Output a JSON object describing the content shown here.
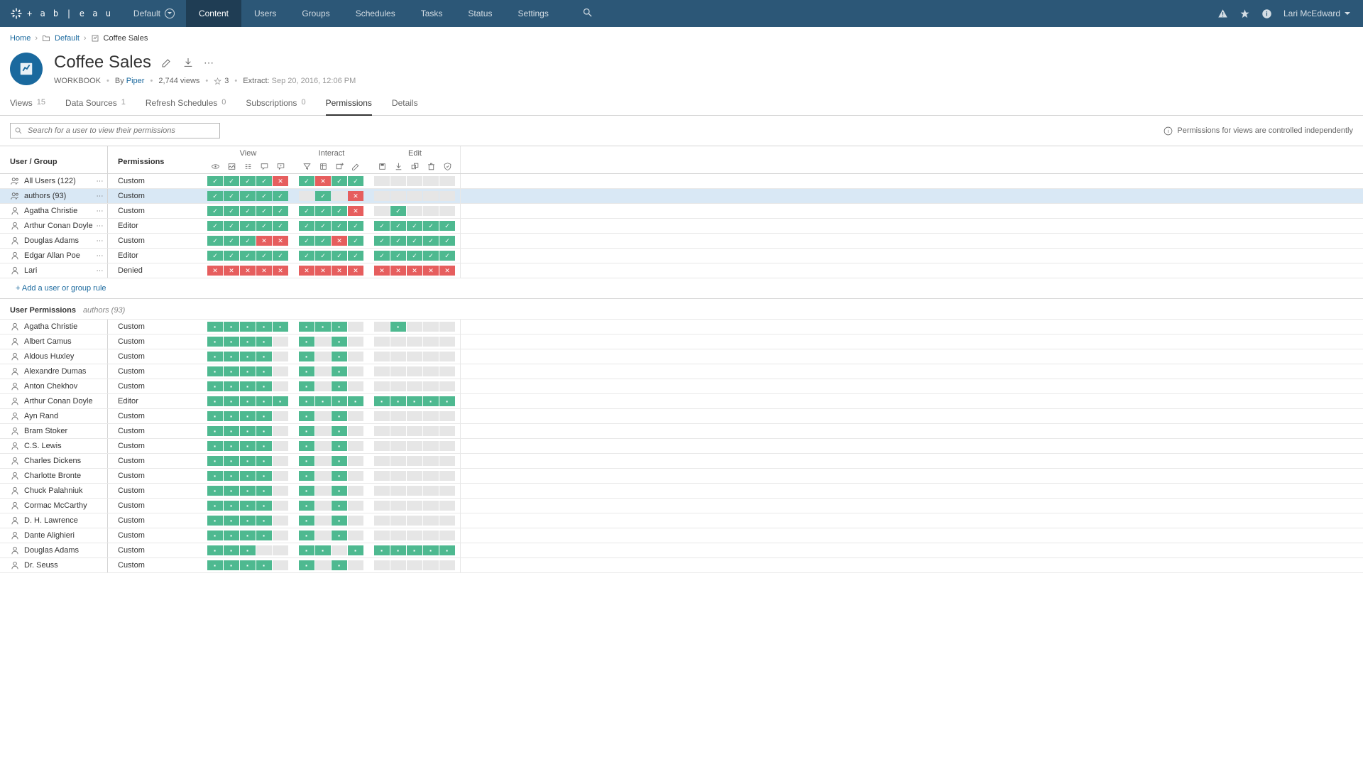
{
  "nav": {
    "site": "Default",
    "items": [
      "Content",
      "Users",
      "Groups",
      "Schedules",
      "Tasks",
      "Status",
      "Settings"
    ],
    "active": 0,
    "username": "Lari McEdward"
  },
  "breadcrumb": {
    "home": "Home",
    "site": "Default",
    "current": "Coffee Sales"
  },
  "header": {
    "title": "Coffee Sales",
    "type": "WORKBOOK",
    "by_label": "By",
    "owner": "Piper",
    "views": "2,744 views",
    "stars": "3",
    "extract_label": "Extract:",
    "extract_time": "Sep 20, 2016, 12:06 PM"
  },
  "tabs": [
    {
      "label": "Views",
      "count": "15"
    },
    {
      "label": "Data Sources",
      "count": "1"
    },
    {
      "label": "Refresh Schedules",
      "count": "0"
    },
    {
      "label": "Subscriptions",
      "count": "0"
    },
    {
      "label": "Permissions"
    },
    {
      "label": "Details"
    }
  ],
  "search_placeholder": "Search for a user to view their permissions",
  "info_notice": "Permissions for views are controlled independently",
  "grid": {
    "col_ug": "User / Group",
    "col_perm": "Permissions",
    "groups": [
      "View",
      "Interact",
      "Edit"
    ]
  },
  "rules": [
    {
      "type": "group",
      "name": "All Users (122)",
      "perm": "Custom",
      "view": [
        "a",
        "a",
        "a",
        "a",
        "d"
      ],
      "interact": [
        "a",
        "d",
        "a",
        "a"
      ],
      "edit": [
        "n",
        "n",
        "n",
        "n",
        "n"
      ]
    },
    {
      "type": "group",
      "name": "authors (93)",
      "perm": "Custom",
      "selected": true,
      "view": [
        "a",
        "a",
        "a",
        "a",
        "a"
      ],
      "interact": [
        "n",
        "a",
        "n",
        "d"
      ],
      "edit": [
        "n",
        "n",
        "n",
        "n",
        "n"
      ]
    },
    {
      "type": "user",
      "name": "Agatha Christie",
      "perm": "Custom",
      "view": [
        "a",
        "a",
        "a",
        "a",
        "a"
      ],
      "interact": [
        "a",
        "a",
        "a",
        "d"
      ],
      "edit": [
        "n",
        "a",
        "n",
        "n",
        "n"
      ]
    },
    {
      "type": "user",
      "name": "Arthur Conan Doyle",
      "perm": "Editor",
      "view": [
        "a",
        "a",
        "a",
        "a",
        "a"
      ],
      "interact": [
        "a",
        "a",
        "a",
        "a"
      ],
      "edit": [
        "a",
        "a",
        "a",
        "a",
        "a"
      ]
    },
    {
      "type": "user",
      "name": "Douglas Adams",
      "perm": "Custom",
      "view": [
        "a",
        "a",
        "a",
        "d",
        "d"
      ],
      "interact": [
        "a",
        "a",
        "d",
        "a"
      ],
      "edit": [
        "a",
        "a",
        "a",
        "a",
        "a"
      ]
    },
    {
      "type": "user",
      "name": "Edgar Allan Poe",
      "perm": "Editor",
      "view": [
        "a",
        "a",
        "a",
        "a",
        "a"
      ],
      "interact": [
        "a",
        "a",
        "a",
        "a"
      ],
      "edit": [
        "a",
        "a",
        "a",
        "a",
        "a"
      ]
    },
    {
      "type": "user",
      "name": "Lari",
      "perm": "Denied",
      "view": [
        "d",
        "d",
        "d",
        "d",
        "d"
      ],
      "interact": [
        "d",
        "d",
        "d",
        "d"
      ],
      "edit": [
        "d",
        "d",
        "d",
        "d",
        "d"
      ]
    }
  ],
  "add_rule": "+ Add a user or group rule",
  "user_perms": {
    "title": "User Permissions",
    "sub": "authors (93)",
    "rows": [
      {
        "name": "Agatha Christie",
        "perm": "Custom",
        "view": [
          "o",
          "o",
          "o",
          "o",
          "o"
        ],
        "interact": [
          "o",
          "o",
          "o",
          "n"
        ],
        "edit": [
          "n",
          "o",
          "n",
          "n",
          "n"
        ]
      },
      {
        "name": "Albert Camus",
        "perm": "Custom",
        "view": [
          "o",
          "o",
          "o",
          "o",
          "n"
        ],
        "interact": [
          "o",
          "n",
          "o",
          "n"
        ],
        "edit": [
          "n",
          "n",
          "n",
          "n",
          "n"
        ]
      },
      {
        "name": "Aldous Huxley",
        "perm": "Custom",
        "view": [
          "o",
          "o",
          "o",
          "o",
          "n"
        ],
        "interact": [
          "o",
          "n",
          "o",
          "n"
        ],
        "edit": [
          "n",
          "n",
          "n",
          "n",
          "n"
        ]
      },
      {
        "name": "Alexandre Dumas",
        "perm": "Custom",
        "view": [
          "o",
          "o",
          "o",
          "o",
          "n"
        ],
        "interact": [
          "o",
          "n",
          "o",
          "n"
        ],
        "edit": [
          "n",
          "n",
          "n",
          "n",
          "n"
        ]
      },
      {
        "name": "Anton Chekhov",
        "perm": "Custom",
        "view": [
          "o",
          "o",
          "o",
          "o",
          "n"
        ],
        "interact": [
          "o",
          "n",
          "o",
          "n"
        ],
        "edit": [
          "n",
          "n",
          "n",
          "n",
          "n"
        ]
      },
      {
        "name": "Arthur Conan Doyle",
        "perm": "Editor",
        "view": [
          "o",
          "o",
          "o",
          "o",
          "o"
        ],
        "interact": [
          "o",
          "o",
          "o",
          "o"
        ],
        "edit": [
          "o",
          "o",
          "o",
          "o",
          "o"
        ]
      },
      {
        "name": "Ayn Rand",
        "perm": "Custom",
        "view": [
          "o",
          "o",
          "o",
          "o",
          "n"
        ],
        "interact": [
          "o",
          "n",
          "o",
          "n"
        ],
        "edit": [
          "n",
          "n",
          "n",
          "n",
          "n"
        ]
      },
      {
        "name": "Bram Stoker",
        "perm": "Custom",
        "view": [
          "o",
          "o",
          "o",
          "o",
          "n"
        ],
        "interact": [
          "o",
          "n",
          "o",
          "n"
        ],
        "edit": [
          "n",
          "n",
          "n",
          "n",
          "n"
        ]
      },
      {
        "name": "C.S. Lewis",
        "perm": "Custom",
        "view": [
          "o",
          "o",
          "o",
          "o",
          "n"
        ],
        "interact": [
          "o",
          "n",
          "o",
          "n"
        ],
        "edit": [
          "n",
          "n",
          "n",
          "n",
          "n"
        ]
      },
      {
        "name": "Charles Dickens",
        "perm": "Custom",
        "view": [
          "o",
          "o",
          "o",
          "o",
          "n"
        ],
        "interact": [
          "o",
          "n",
          "o",
          "n"
        ],
        "edit": [
          "n",
          "n",
          "n",
          "n",
          "n"
        ]
      },
      {
        "name": "Charlotte Bronte",
        "perm": "Custom",
        "view": [
          "o",
          "o",
          "o",
          "o",
          "n"
        ],
        "interact": [
          "o",
          "n",
          "o",
          "n"
        ],
        "edit": [
          "n",
          "n",
          "n",
          "n",
          "n"
        ]
      },
      {
        "name": "Chuck Palahniuk",
        "perm": "Custom",
        "view": [
          "o",
          "o",
          "o",
          "o",
          "n"
        ],
        "interact": [
          "o",
          "n",
          "o",
          "n"
        ],
        "edit": [
          "n",
          "n",
          "n",
          "n",
          "n"
        ]
      },
      {
        "name": "Cormac McCarthy",
        "perm": "Custom",
        "view": [
          "o",
          "o",
          "o",
          "o",
          "n"
        ],
        "interact": [
          "o",
          "n",
          "o",
          "n"
        ],
        "edit": [
          "n",
          "n",
          "n",
          "n",
          "n"
        ]
      },
      {
        "name": "D. H. Lawrence",
        "perm": "Custom",
        "view": [
          "o",
          "o",
          "o",
          "o",
          "n"
        ],
        "interact": [
          "o",
          "n",
          "o",
          "n"
        ],
        "edit": [
          "n",
          "n",
          "n",
          "n",
          "n"
        ]
      },
      {
        "name": "Dante Alighieri",
        "perm": "Custom",
        "view": [
          "o",
          "o",
          "o",
          "o",
          "n"
        ],
        "interact": [
          "o",
          "n",
          "o",
          "n"
        ],
        "edit": [
          "n",
          "n",
          "n",
          "n",
          "n"
        ]
      },
      {
        "name": "Douglas Adams",
        "perm": "Custom",
        "view": [
          "o",
          "o",
          "o",
          "n",
          "n"
        ],
        "interact": [
          "o",
          "o",
          "n",
          "o"
        ],
        "edit": [
          "o",
          "o",
          "o",
          "o",
          "o"
        ]
      },
      {
        "name": "Dr. Seuss",
        "perm": "Custom",
        "view": [
          "o",
          "o",
          "o",
          "o",
          "n"
        ],
        "interact": [
          "o",
          "n",
          "o",
          "n"
        ],
        "edit": [
          "n",
          "n",
          "n",
          "n",
          "n"
        ]
      }
    ]
  }
}
